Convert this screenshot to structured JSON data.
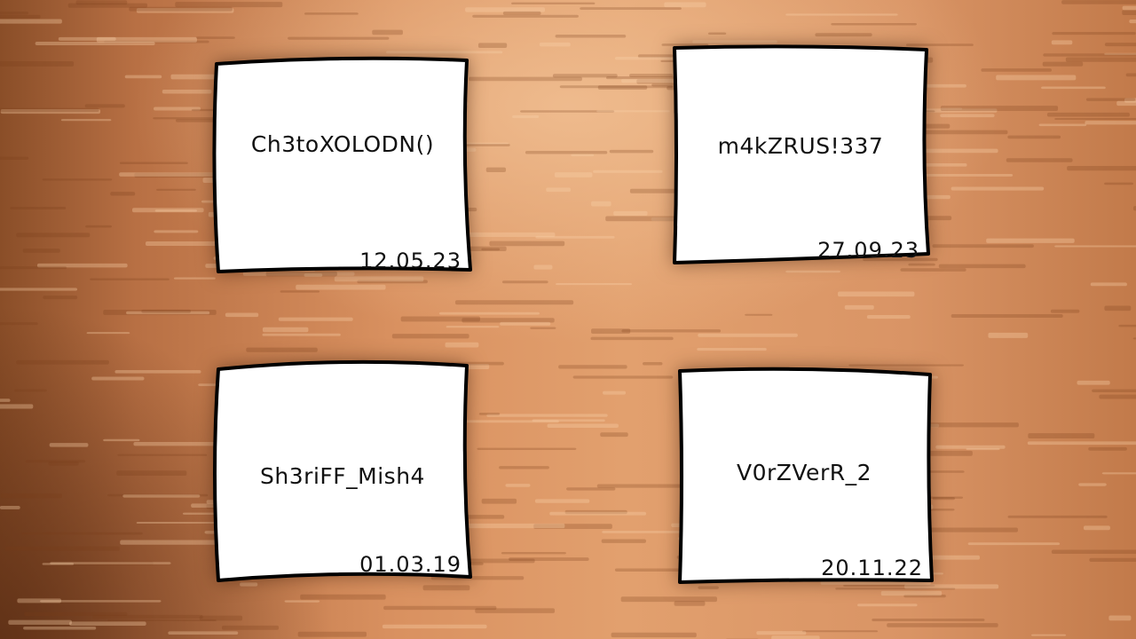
{
  "notes": [
    {
      "name": "Ch3toXOLODN()",
      "date": "12.05.23"
    },
    {
      "name": "m4kZRUS!337",
      "date": "27.09.23"
    },
    {
      "name": "Sh3riFF_Mish4",
      "date": "01.03.19"
    },
    {
      "name": "V0rZVerR_2",
      "date": "20.11.22"
    }
  ],
  "colors": {
    "paper": "#ffffff",
    "outline": "#000000",
    "wood_light": "#e8aa78",
    "wood_dark": "#8a4e28"
  }
}
